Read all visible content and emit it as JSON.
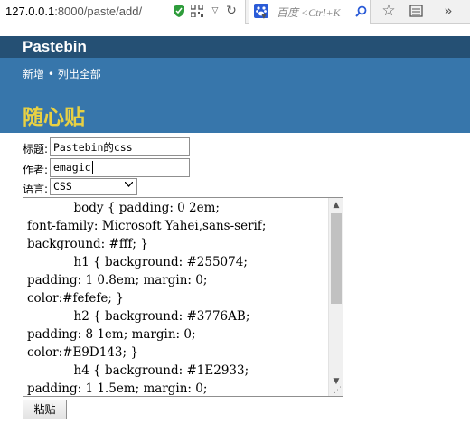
{
  "browser": {
    "url_host": "127.0.0.1",
    "url_path": ":8000/paste/add/",
    "search_placeholder": "百度 <Ctrl+K",
    "icons": [
      "shield-icon",
      "qr-icon",
      "dropdown-icon",
      "refresh-icon",
      "baidu-paw-icon",
      "search-icon",
      "star-icon",
      "reader-icon",
      "overflow-icon"
    ]
  },
  "site": {
    "title": "Pastebin",
    "nav_new": "新增",
    "nav_sep": "•",
    "nav_list": "列出全部",
    "heading": "随心贴",
    "colors": {
      "bar": "#255074",
      "header": "#3776AB",
      "heading": "#E9D143"
    }
  },
  "form": {
    "title_label": "标题:",
    "title_value": "Pastebin的css",
    "author_label": "作者:",
    "author_value": "emagic",
    "lang_label": "语言:",
    "lang_value": "CSS",
    "code_lines": [
      "            body { padding: 0 2em;",
      "font-family: Microsoft Yahei,sans-serif;",
      "background: #fff; }",
      "            h1 { background: #255074;",
      "padding: 1 0.8em; margin: 0;",
      "color:#fefefe; }",
      "            h2 { background: #3776AB;",
      "padding: 8 1em; margin: 0;",
      "color:#E9D143; }",
      "            h4 { background: #1E2933;",
      "padding: 1 1.5em; margin: 0;"
    ],
    "submit_label": "粘贴"
  }
}
